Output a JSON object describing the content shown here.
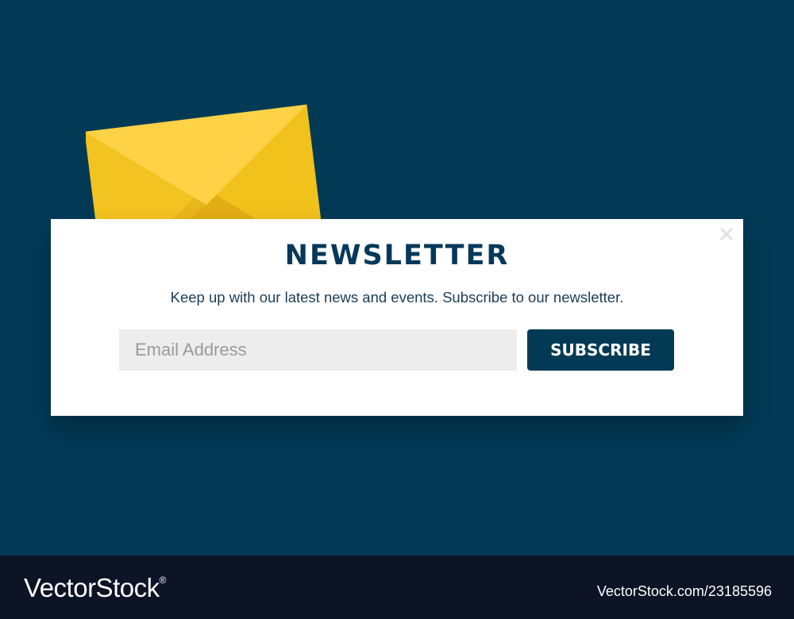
{
  "popup": {
    "title": "NEWSLETTER",
    "subtitle": "Keep up with our latest news and events. Subscribe to our newsletter.",
    "email_placeholder": "Email Address",
    "subscribe_label": "SUBSCRIBE",
    "close_icon": "close-icon"
  },
  "illustration": {
    "icon": "envelope-icon"
  },
  "footer": {
    "brand": "VectorStock",
    "brand_mark": "®",
    "image_id": "VectorStock.com/23185596"
  },
  "colors": {
    "background": "#023a56",
    "popup": "#ffffff",
    "title": "#05385a",
    "button": "#023a56",
    "input": "#ededed",
    "envelope": "#f0c11e",
    "footer": "#0d1425"
  }
}
